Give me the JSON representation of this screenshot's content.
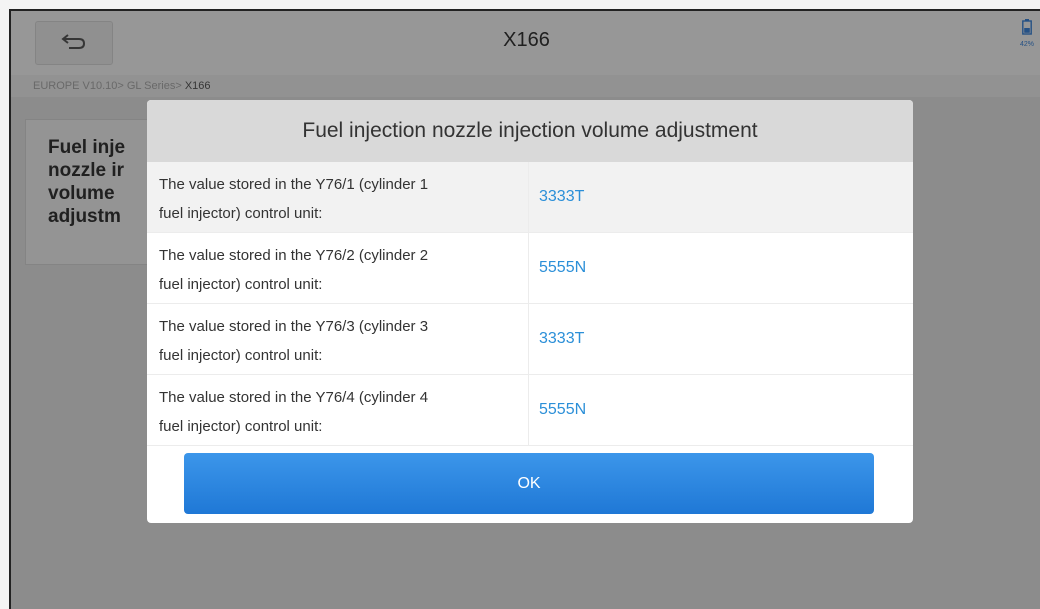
{
  "header": {
    "title": "X166",
    "battery": "42%"
  },
  "breadcrumb": {
    "prefix": "EUROPE V10.10> GL Series> ",
    "current": "X166"
  },
  "background_card": {
    "label": "Fuel inje\nnozzle ir\nvolume\nadjustm"
  },
  "dialog": {
    "title": "Fuel injection nozzle injection volume adjustment",
    "rows": [
      {
        "label_line1": "The value stored in the Y76/1 (cylinder 1",
        "label_line2": "fuel injector) control unit:",
        "value": "3333T"
      },
      {
        "label_line1": "The value stored in the Y76/2 (cylinder 2",
        "label_line2": "fuel injector) control unit:",
        "value": "5555N"
      },
      {
        "label_line1": "The value stored in the Y76/3 (cylinder 3",
        "label_line2": "fuel injector) control unit:",
        "value": "3333T"
      },
      {
        "label_line1": "The value stored in the Y76/4 (cylinder 4",
        "label_line2": "fuel injector) control unit:",
        "value": "5555N"
      }
    ],
    "ok_label": "OK"
  },
  "icons": {
    "back": "back-arrow-icon",
    "battery": "battery-icon"
  },
  "colors": {
    "accent": "#2b8fd8",
    "button": "#2a86e0"
  }
}
